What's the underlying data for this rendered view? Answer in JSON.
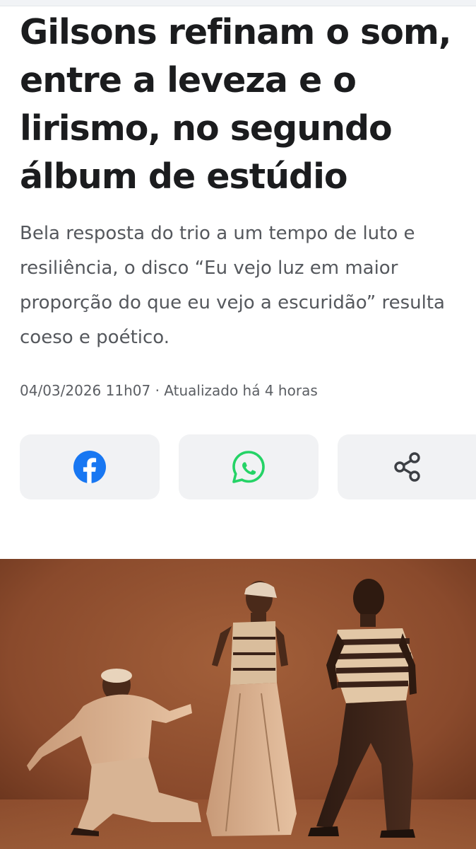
{
  "article": {
    "headline": "Gilsons refinam o som, entre a leveza e o lirismo, no segundo álbum de estúdio",
    "subtitle": "Bela resposta do trio a um tempo de luto e resiliência, o disco “Eu vejo luz em maior proporção do que eu vejo a escuridão” resulta coeso e poético.",
    "date": "04/03/2026 11h07",
    "separator": "·",
    "updated": "Atualizado há 4 horas"
  },
  "share": {
    "buttons": [
      {
        "icon": "facebook-icon",
        "color": "#1877f2"
      },
      {
        "icon": "whatsapp-icon",
        "color": "#25d366"
      },
      {
        "icon": "share-icon",
        "color": "#3c3f44"
      }
    ]
  },
  "photo": {
    "description_colors": {
      "background": "#8a4a2c",
      "tone": "sepia"
    }
  }
}
